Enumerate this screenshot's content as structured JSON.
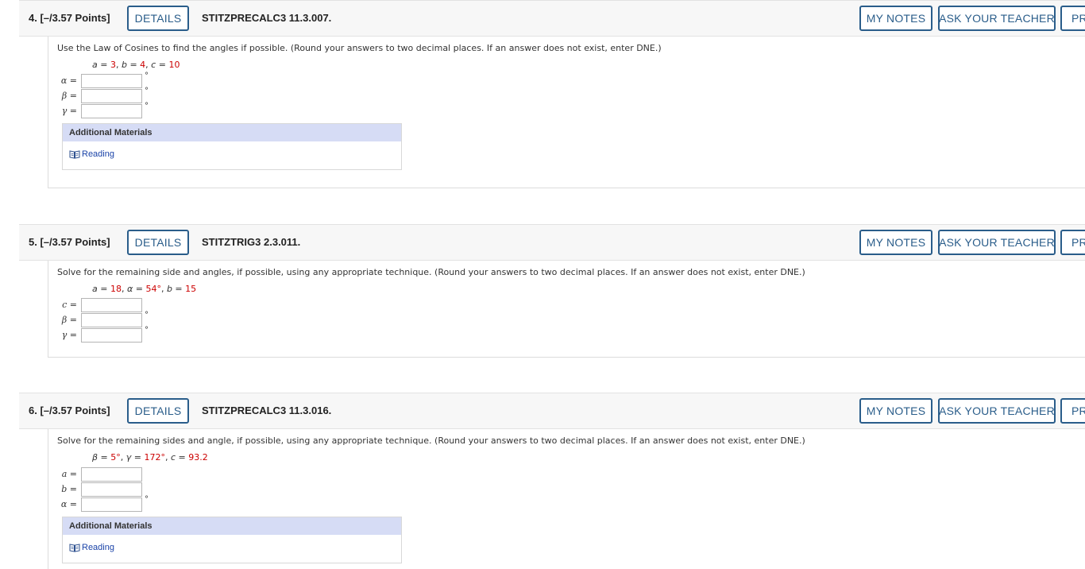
{
  "header_buttons": {
    "details": "DETAILS",
    "my_notes": "MY NOTES",
    "ask_teacher": "ASK YOUR TEACHER",
    "practice_partial": "PR"
  },
  "degree_symbol": "°",
  "equals": "=",
  "additional_materials": {
    "heading": "Additional Materials",
    "link_label": "Reading"
  },
  "questions": [
    {
      "number_points": "4.  [–/3.57 Points]",
      "code": "STITZPRECALC3 11.3.007.",
      "prompt": "Use the Law of Cosines to find the angles if possible. (Round your answers to two decimal places. If an answer does not exist, enter DNE.)",
      "givens": [
        {
          "var": "a",
          "val": "3"
        },
        {
          "var": "b",
          "val": "4"
        },
        {
          "var": "c",
          "val": "10"
        }
      ],
      "answers": [
        {
          "label": "α",
          "value": "",
          "degree": true
        },
        {
          "label": "β",
          "value": "",
          "degree": true
        },
        {
          "label": "γ",
          "value": "",
          "degree": true
        }
      ]
    },
    {
      "number_points": "5.  [–/3.57 Points]",
      "code": "STITZTRIG3 2.3.011.",
      "prompt": "Solve for the remaining side and angles, if possible, using any appropriate technique. (Round your answers to two decimal places. If an answer does not exist, enter DNE.)",
      "givens": [
        {
          "var": "a",
          "val": "18"
        },
        {
          "var": "α",
          "val": "54°"
        },
        {
          "var": "b",
          "val": "15"
        }
      ],
      "answers": [
        {
          "label": "c",
          "value": "",
          "degree": false
        },
        {
          "label": "β",
          "value": "",
          "degree": true
        },
        {
          "label": "γ",
          "value": "",
          "degree": true
        }
      ]
    },
    {
      "number_points": "6.  [–/3.57 Points]",
      "code": "STITZPRECALC3 11.3.016.",
      "prompt": "Solve for the remaining sides and angle, if possible, using any appropriate technique. (Round your answers to two decimal places. If an answer does not exist, enter DNE.)",
      "givens": [
        {
          "var": "β",
          "val": "5°"
        },
        {
          "var": "γ",
          "val": "172°"
        },
        {
          "var": "c",
          "val": "93.2"
        }
      ],
      "answers": [
        {
          "label": "a",
          "value": "",
          "degree": false
        },
        {
          "label": "b",
          "value": "",
          "degree": false
        },
        {
          "label": "α",
          "value": "",
          "degree": true
        }
      ]
    }
  ]
}
